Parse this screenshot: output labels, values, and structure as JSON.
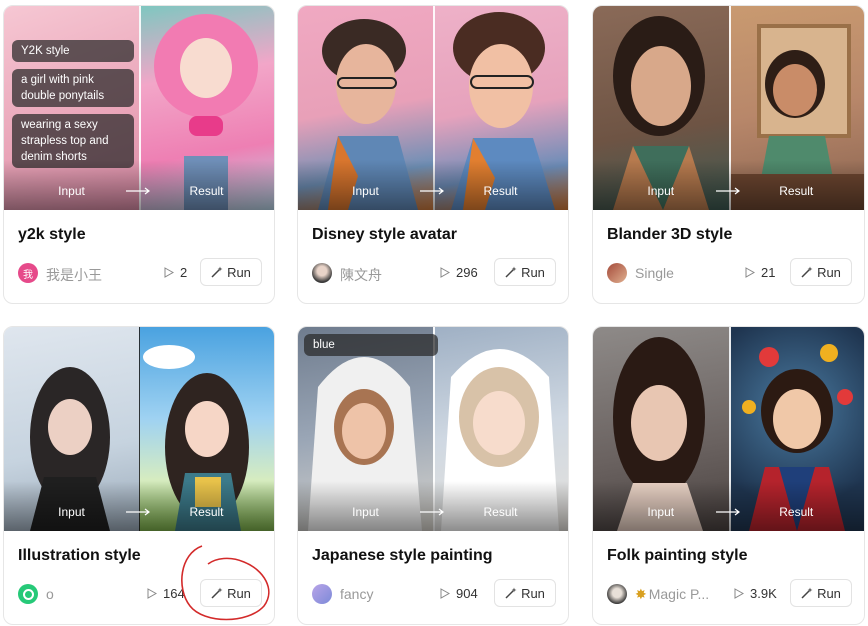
{
  "labels": {
    "input": "Input",
    "result": "Result",
    "run": "Run"
  },
  "cards": [
    {
      "title": "y2k style",
      "author": "我是小王",
      "avatar_text": "我",
      "plays": "2",
      "prompt_tags": [
        "Y2K style",
        "a girl with pink double ponytails",
        "wearing a sexy strapless top and denim shorts"
      ],
      "colors": {
        "left": "#f2b0c0",
        "right": "#f08ab4",
        "accent": "#e64a8a"
      }
    },
    {
      "title": "Disney style avatar",
      "author": "陳文舟",
      "plays": "296",
      "colors": {
        "left": "#e89bb5",
        "right": "#d98aa8",
        "accent": "#5a86b8"
      }
    },
    {
      "title": "Blander 3D style",
      "author": "Single",
      "plays": "21",
      "colors": {
        "left": "#7a5a48",
        "right": "#b8876a",
        "accent": "#3f6e5b"
      }
    },
    {
      "title": "Illustration style",
      "author": "o",
      "plays": "164",
      "colors": {
        "left": "#c9d8e4",
        "right": "#8fc3ea",
        "accent": "#26c978"
      }
    },
    {
      "title": "Japanese style painting",
      "author": "fancy",
      "plays": "904",
      "prompt_tags": [
        "blue"
      ],
      "colors": {
        "left": "#8b97a8",
        "right": "#c8d3e0",
        "accent": "#9aa6e6"
      }
    },
    {
      "title": "Folk painting style",
      "author": "Magic P...",
      "plays": "3.9K",
      "colors": {
        "left": "#5a4a44",
        "right": "#2b4a6a",
        "accent": "#d9a020"
      }
    }
  ]
}
